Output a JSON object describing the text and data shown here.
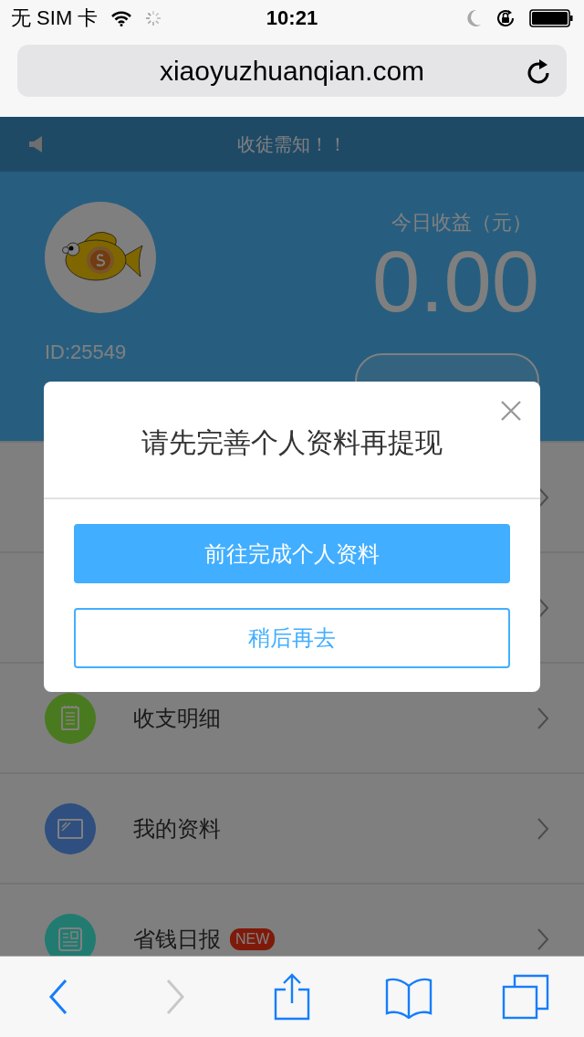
{
  "status_bar": {
    "carrier": "无 SIM 卡",
    "time": "10:21"
  },
  "address_bar": {
    "url": "xiaoyuzhuanqian.com"
  },
  "notice": {
    "text": "收徒需知！！"
  },
  "profile": {
    "id": "ID:25549",
    "earnings_label": "今日收益（元）",
    "earnings": "0.00"
  },
  "menu": [
    {
      "kind": "covered"
    },
    {
      "kind": "covered"
    },
    {
      "kind": "entry",
      "label": "收支明细",
      "color": "#4a7a1f"
    },
    {
      "kind": "entry",
      "label": "我的资料",
      "color": "#2e4f80"
    },
    {
      "kind": "entry",
      "label": "省钱日报",
      "color": "#217b70",
      "badge": "NEW"
    }
  ],
  "dialog": {
    "title": "请先完善个人资料再提现",
    "primary_button": "前往完成个人资料",
    "secondary_button": "稍后再去"
  }
}
